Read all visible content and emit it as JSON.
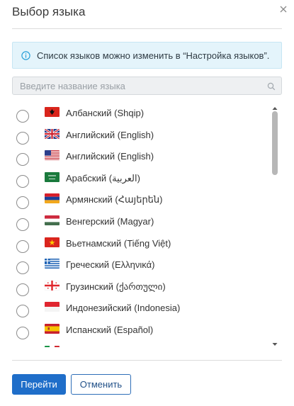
{
  "dialog": {
    "title": "Выбор языка",
    "info_text": "Список языков можно изменить в “Настройка языков”.",
    "search_placeholder": "Введите название языка",
    "languages": [
      {
        "label": "Албанский (Shqip)",
        "flag": "albania-flag-icon"
      },
      {
        "label": "Английский (English)",
        "flag": "uk-flag-icon"
      },
      {
        "label": "Английский (English)",
        "flag": "us-flag-icon"
      },
      {
        "label": "Арабский (العربية)",
        "flag": "saudi-arabia-flag-icon"
      },
      {
        "label": "Армянский (Հայերեն)",
        "flag": "armenia-flag-icon"
      },
      {
        "label": "Венгерский (Magyar)",
        "flag": "hungary-flag-icon"
      },
      {
        "label": "Вьетнамский (Tiếng Việt)",
        "flag": "vietnam-flag-icon"
      },
      {
        "label": "Греческий (Ελληνικά)",
        "flag": "greece-flag-icon"
      },
      {
        "label": "Грузинский (ქართული)",
        "flag": "georgia-flag-icon"
      },
      {
        "label": "Индонезийский (Indonesia)",
        "flag": "indonesia-flag-icon"
      },
      {
        "label": "Испанский (Español)",
        "flag": "spain-flag-icon"
      },
      {
        "label": "",
        "flag": "italy-flag-icon"
      }
    ],
    "go_button": "Перейти",
    "cancel_button": "Отменить"
  },
  "colors": {
    "primary": "#1f6ec9",
    "info_bg": "#e4f4fb",
    "info_icon": "#2aa0d8"
  }
}
